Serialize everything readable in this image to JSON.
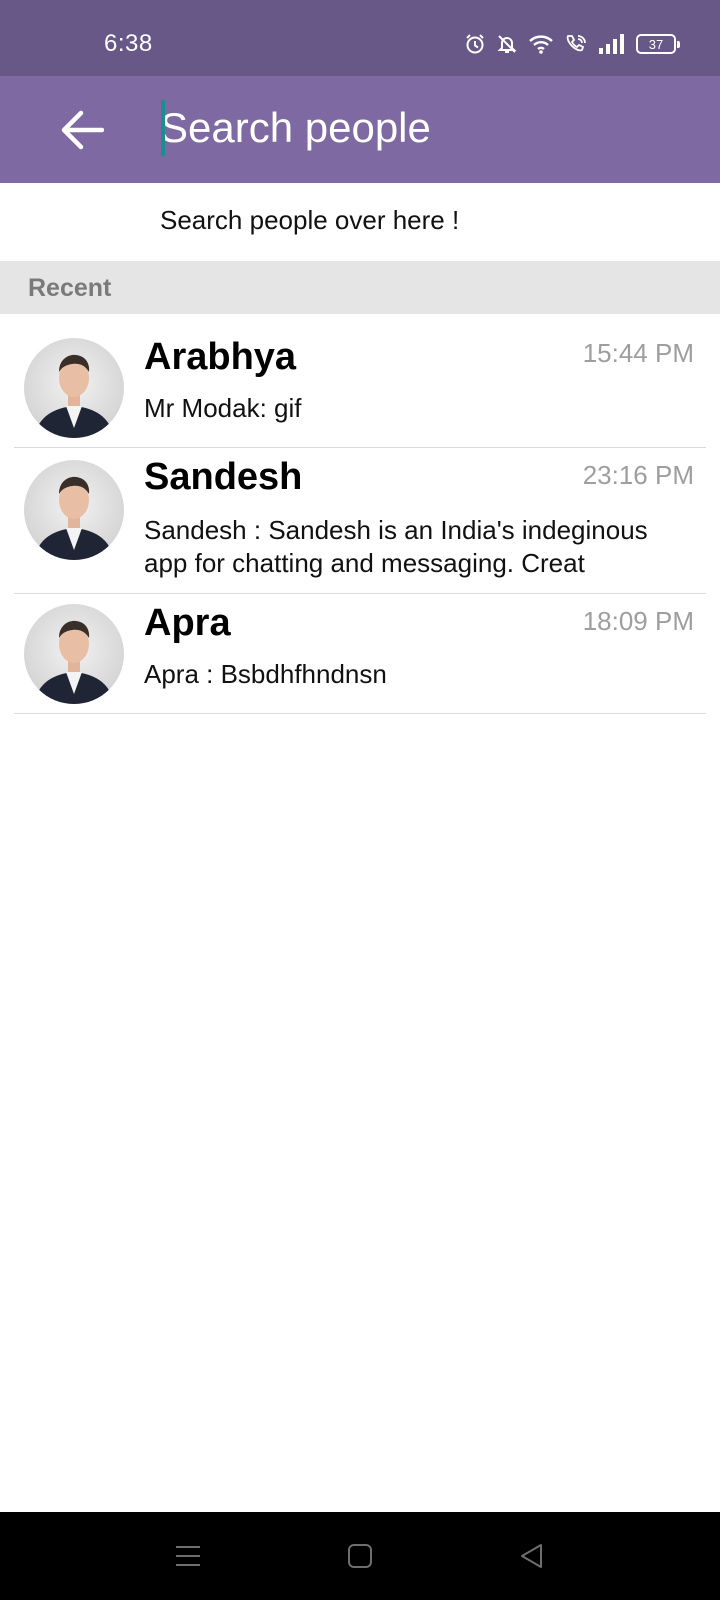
{
  "status_bar": {
    "time": "6:38",
    "battery": "37",
    "icons": [
      "alarm-icon",
      "bell-off-icon",
      "wifi-icon",
      "wifi-call-icon",
      "signal-icon",
      "battery-icon"
    ]
  },
  "app_bar": {
    "search_placeholder": "Search people",
    "back_icon": "arrow-left-icon",
    "color": "#7e69a2"
  },
  "hint": "Search people over here !",
  "recent": {
    "label": "Recent",
    "items": [
      {
        "name": "Arabhya",
        "time": "15:44 PM",
        "preview": "Mr Modak: gif"
      },
      {
        "name": "Sandesh",
        "time": "23:16 PM",
        "preview": "Sandesh : Sandesh is an India's indeginous app for chatting and messaging. Creat"
      },
      {
        "name": "Apra",
        "time": "18:09 PM",
        "preview": "Apra : Bsbdhfhndnsn"
      }
    ]
  },
  "nav_bar": {
    "icons": [
      "menu-icon",
      "home-square-icon",
      "back-triangle-icon"
    ]
  }
}
